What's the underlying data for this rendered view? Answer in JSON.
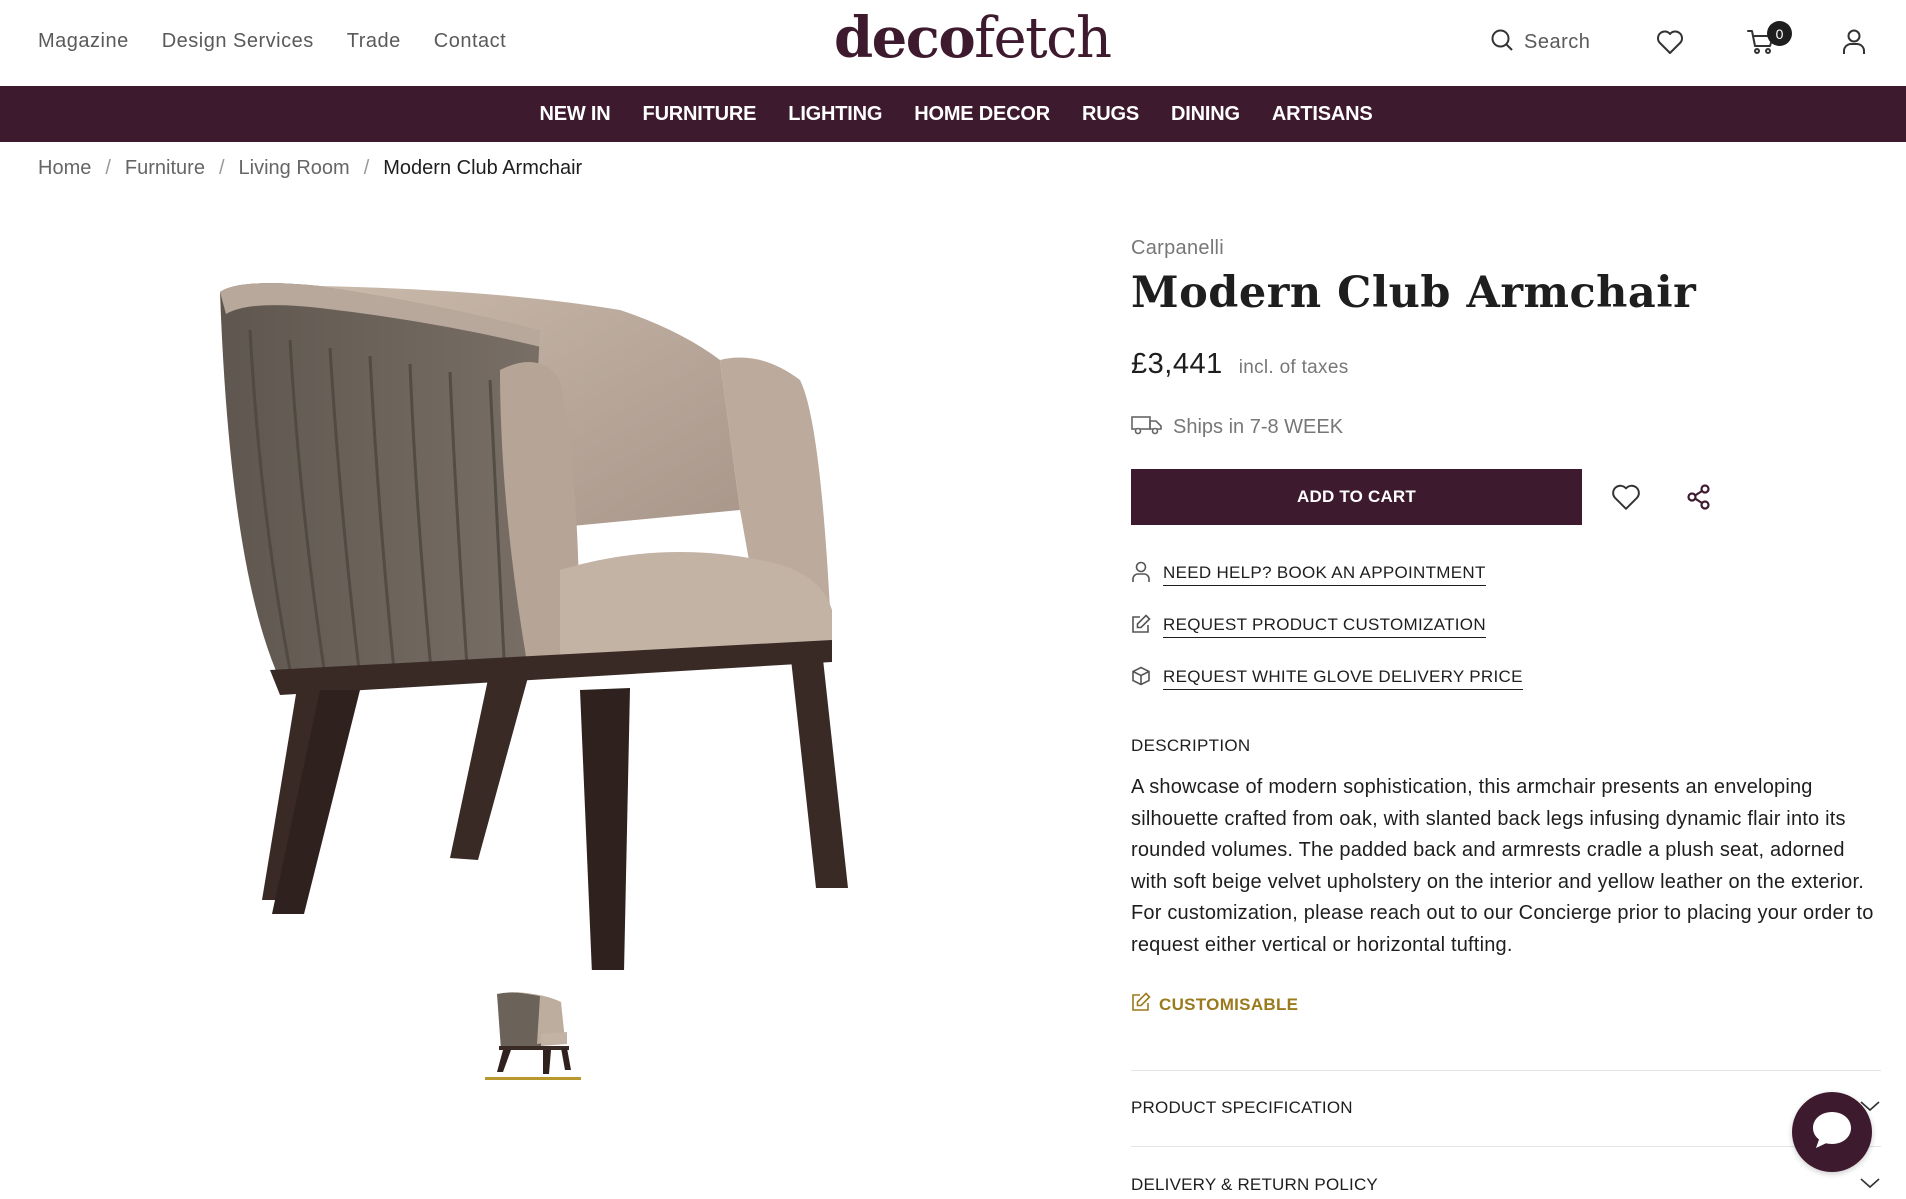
{
  "header": {
    "top_links": [
      "Magazine",
      "Design Services",
      "Trade",
      "Contact"
    ],
    "logo_bold": "deco",
    "logo_light": "fetch",
    "search_label": "Search",
    "cart_count": "0"
  },
  "categories": [
    "NEW IN",
    "FURNITURE",
    "LIGHTING",
    "HOME DECOR",
    "RUGS",
    "DINING",
    "ARTISANS"
  ],
  "breadcrumb": {
    "items": [
      "Home",
      "Furniture",
      "Living Room"
    ],
    "current": "Modern Club Armchair",
    "separator": "/"
  },
  "product": {
    "brand": "Carpanelli",
    "title": "Modern Club Armchair",
    "price": "£3,441",
    "tax_note": "incl. of taxes",
    "shipping": "Ships in 7-8 WEEK",
    "add_to_cart": "ADD TO CART",
    "links": [
      {
        "label": "NEED HELP? BOOK AN APPOINTMENT",
        "icon": "user-icon"
      },
      {
        "label": "REQUEST PRODUCT CUSTOMIZATION",
        "icon": "edit-icon"
      },
      {
        "label": "REQUEST WHITE GLOVE DELIVERY PRICE",
        "icon": "box-icon"
      }
    ],
    "description_heading": "DESCRIPTION",
    "description": "A showcase of modern sophistication, this armchair presents an enveloping silhouette crafted from oak, with slanted back legs infusing dynamic flair into its rounded volumes. The padded back and armrests cradle a plush seat, adorned with soft beige velvet upholstery on the interior and yellow leather on the exterior. For customization, please reach out to our Concierge prior to placing your order to request either vertical or horizontal tufting.",
    "customisable": "CUSTOMISABLE",
    "accordions": [
      "PRODUCT SPECIFICATION",
      "DELIVERY & RETURN POLICY"
    ]
  },
  "colors": {
    "brand": "#3e1a2e",
    "accent_gold": "#9a7a1c"
  }
}
